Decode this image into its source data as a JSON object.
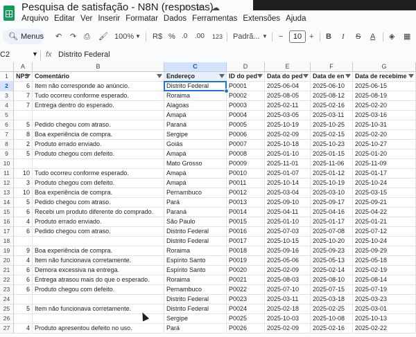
{
  "document": {
    "title": "Pesquisa de satisfação - N8N (respostas)",
    "menu": [
      "Arquivo",
      "Editar",
      "Ver",
      "Inserir",
      "Formatar",
      "Dados",
      "Ferramentas",
      "Extensões",
      "Ajuda"
    ]
  },
  "toolbar": {
    "menus_label": "Menus",
    "zoom": "100%",
    "currency": "R$",
    "percent": "%",
    "decimal_dec": ".0",
    "decimal_inc": ".00",
    "number_format": "123",
    "font_name": "Padrã...",
    "font_size": "10",
    "minus": "−",
    "plus": "+",
    "bold": "B",
    "italic": "I",
    "strike": "S",
    "text_color": "A"
  },
  "formula_bar": {
    "cell_ref": "C2",
    "fx": "fx",
    "content": "Distrito Federal"
  },
  "selected_col_letter": "C",
  "selected_row_number": "2",
  "grid": {
    "column_letters": [
      "A",
      "B",
      "C",
      "D",
      "E",
      "F",
      "G"
    ],
    "header_row": [
      "NPS",
      "Comentário",
      "Endereço",
      "ID do ped",
      "Data do ped",
      "Data de en",
      "Data de recebime"
    ],
    "rows": [
      [
        "6",
        "Item não corresponde ao anúncio.",
        "Distrito Federal",
        "P0001",
        "2025-06-04",
        "2025-06-10",
        "2025-06-15"
      ],
      [
        "7",
        "Tudo ocorreu conforme esperado.",
        "Roraima",
        "P0002",
        "2025-08-05",
        "2025-08-12",
        "2025-08-19"
      ],
      [
        "7",
        "Entrega dentro do esperado.",
        "Alagoas",
        "P0003",
        "2025-02-11",
        "2025-02-16",
        "2025-02-20"
      ],
      [
        "",
        "",
        "Amapá",
        "P0004",
        "2025-03-05",
        "2025-03-11",
        "2025-03-16"
      ],
      [
        "5",
        "Pedido chegou com atraso.",
        "Paraná",
        "P0005",
        "2025-10-19",
        "2025-10-25",
        "2025-10-31"
      ],
      [
        "8",
        "Boa experiência de compra.",
        "Sergipe",
        "P0006",
        "2025-02-09",
        "2025-02-15",
        "2025-02-20"
      ],
      [
        "2",
        "Produto errado enviado.",
        "Goiás",
        "P0007",
        "2025-10-18",
        "2025-10-23",
        "2025-10-27"
      ],
      [
        "5",
        "Produto chegou com defeito.",
        "Amapá",
        "P0008",
        "2025-01-10",
        "2025-01-15",
        "2025-01-20"
      ],
      [
        "",
        "",
        "Mato Grosso",
        "P0009",
        "2025-11-01",
        "2025-11-06",
        "2025-11-09"
      ],
      [
        "10",
        "Tudo ocorreu conforme esperado.",
        "Amapá",
        "P0010",
        "2025-01-07",
        "2025-01-12",
        "2025-01-17"
      ],
      [
        "3",
        "Produto chegou com defeito.",
        "Amapá",
        "P0011",
        "2025-10-14",
        "2025-10-19",
        "2025-10-24"
      ],
      [
        "10",
        "Boa experiência de compra.",
        "Pernambuco",
        "P0012",
        "2025-03-04",
        "2025-03-10",
        "2025-03-15"
      ],
      [
        "5",
        "Pedido chegou com atraso.",
        "Pará",
        "P0013",
        "2025-09-10",
        "2025-09-17",
        "2025-09-21"
      ],
      [
        "6",
        "Recebi um produto diferente do comprado.",
        "Paraná",
        "P0014",
        "2025-04-11",
        "2025-04-16",
        "2025-04-22"
      ],
      [
        "4",
        "Produto errado enviado.",
        "São Paulo",
        "P0015",
        "2025-01-10",
        "2025-01-17",
        "2025-01-21"
      ],
      [
        "6",
        "Pedido chegou com atraso.",
        "Distrito Federal",
        "P0016",
        "2025-07-03",
        "2025-07-08",
        "2025-07-12"
      ],
      [
        "",
        "",
        "Distrito Federal",
        "P0017",
        "2025-10-15",
        "2025-10-20",
        "2025-10-24"
      ],
      [
        "9",
        "Boa experiência de compra.",
        "Roraima",
        "P0018",
        "2025-09-16",
        "2025-09-23",
        "2025-09-29"
      ],
      [
        "4",
        "Item não funcionava corretamente.",
        "Espírito Santo",
        "P0019",
        "2025-05-06",
        "2025-05-13",
        "2025-05-18"
      ],
      [
        "6",
        "Demora excessiva na entrega.",
        "Espírito Santo",
        "P0020",
        "2025-02-09",
        "2025-02-14",
        "2025-02-19"
      ],
      [
        "6",
        "Entrega atrasou mais do que o esperado.",
        "Roraima",
        "P0021",
        "2025-08-03",
        "2025-08-10",
        "2025-08-14"
      ],
      [
        "6",
        "Produto chegou com defeito.",
        "Pernambuco",
        "P0022",
        "2025-07-10",
        "2025-07-15",
        "2025-07-19"
      ],
      [
        "",
        "",
        "Distrito Federal",
        "P0023",
        "2025-03-11",
        "2025-03-18",
        "2025-03-23"
      ],
      [
        "5",
        "Item não funcionava corretamente.",
        "Distrito Federal",
        "P0024",
        "2025-02-18",
        "2025-02-25",
        "2025-03-01"
      ],
      [
        "",
        "",
        "Sergipe",
        "P0025",
        "2025-10-03",
        "2025-10-08",
        "2025-10-13"
      ],
      [
        "4",
        "Produto apresentou defeito no uso.",
        "Pará",
        "P0026",
        "2025-02-09",
        "2025-02-16",
        "2025-02-22"
      ]
    ]
  }
}
